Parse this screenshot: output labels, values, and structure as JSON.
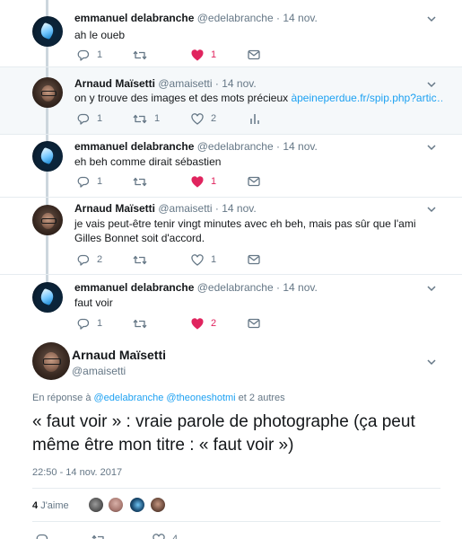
{
  "tweets": [
    {
      "name": "emmanuel delabranche",
      "handle": "@edelabranche",
      "dot": "·",
      "time": "14 nov.",
      "text": "ah le oueb",
      "replies": "1",
      "retweets": "",
      "likes": "1",
      "liked": true
    },
    {
      "name": "Arnaud Maïsetti",
      "handle": "@amaisetti",
      "dot": "·",
      "time": "14 nov.",
      "text": "on y trouve des images et des mots précieux ",
      "link": "àpeineperdue.fr/spip.php?artic…",
      "replies": "1",
      "retweets": "1",
      "likes": "2",
      "liked": false
    },
    {
      "name": "emmanuel delabranche",
      "handle": "@edelabranche",
      "dot": "·",
      "time": "14 nov.",
      "text": "eh beh comme dirait sébastien",
      "replies": "1",
      "retweets": "",
      "likes": "1",
      "liked": true
    },
    {
      "name": "Arnaud Maïsetti",
      "handle": "@amaisetti",
      "dot": "·",
      "time": "14 nov.",
      "text": "je vais peut-être tenir vingt minutes avec eh beh, mais pas sûr que l'ami Gilles Bonnet soit d'accord.",
      "replies": "2",
      "retweets": "",
      "likes": "1",
      "liked": false
    },
    {
      "name": "emmanuel delabranche",
      "handle": "@edelabranche",
      "dot": "·",
      "time": "14 nov.",
      "text": "faut voir",
      "replies": "1",
      "retweets": "",
      "likes": "2",
      "liked": true
    }
  ],
  "main": {
    "name": "Arnaud Maïsetti",
    "handle": "@amaisetti",
    "reply_prefix": "En réponse à ",
    "reply_user1": "@edelabranche",
    "reply_user2": "@theoneshotmi",
    "reply_suffix": " et 2 autres",
    "text": "« faut voir » : vraie parole de photographe (ça peut même être mon titre : « faut voir »)",
    "date": "22:50 - 14 nov. 2017",
    "likes_count": "4",
    "likes_label": "J'aime",
    "bottom_likes": "4"
  },
  "colors": {
    "accent": "#1da1f2",
    "like_red": "#e0245e",
    "muted": "#657786",
    "thread": "#ccd6dd"
  },
  "icons": [
    "reply-icon",
    "retweet-icon",
    "heart-icon",
    "mail-icon",
    "analytics-icon",
    "chevron-down-icon"
  ]
}
